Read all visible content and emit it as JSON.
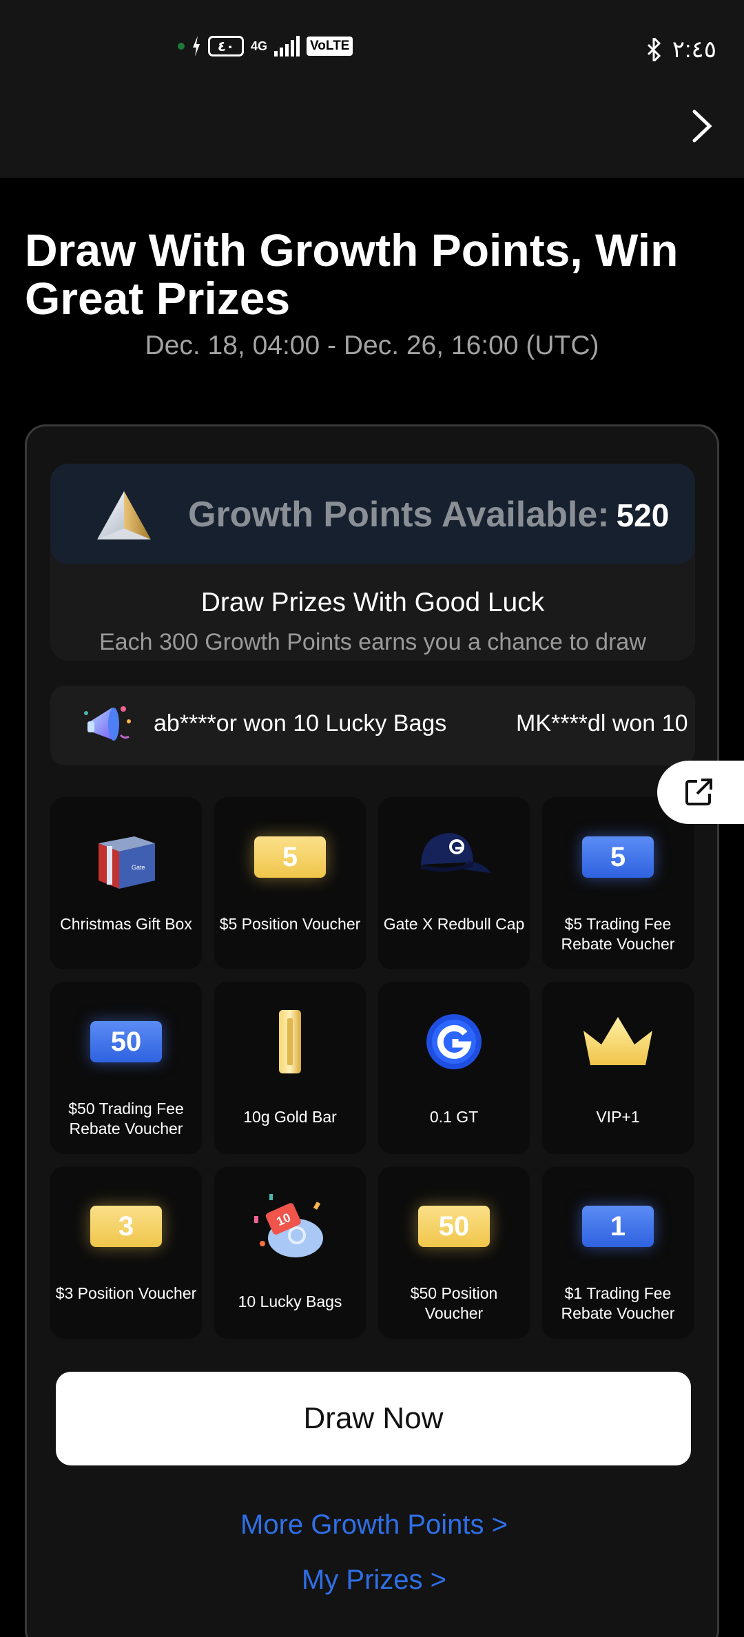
{
  "status_bar": {
    "battery": "٤٠",
    "network": "4G",
    "volte": "VoLTE",
    "time": "٢:٤٥"
  },
  "header": {
    "title": "Draw With Growth Points, Win Great Prizes",
    "dates": "Dec. 18, 04:00 - Dec. 26, 16:00 (UTC)"
  },
  "points": {
    "label": "Growth Points Available:",
    "value": "520",
    "draw_title": "Draw Prizes With Good Luck",
    "draw_subtitle": "Each 300 Growth Points earns you a chance to draw"
  },
  "ticker": {
    "items": [
      "ab****or won 10 Lucky Bags",
      "MK****dl won 10"
    ]
  },
  "prizes": [
    {
      "label": "Christmas Gift Box",
      "icon": "gift-box-icon"
    },
    {
      "label": "$5 Position Voucher",
      "icon": "position-voucher-icon",
      "amount": "5"
    },
    {
      "label": "Gate X Redbull Cap",
      "icon": "cap-icon"
    },
    {
      "label": "$5 Trading Fee Rebate Voucher",
      "icon": "rebate-voucher-icon",
      "amount": "5"
    },
    {
      "label": "$50 Trading Fee Rebate Voucher",
      "icon": "rebate-voucher-icon",
      "amount": "50"
    },
    {
      "label": "10g Gold Bar",
      "icon": "gold-bar-icon"
    },
    {
      "label": "0.1 GT",
      "icon": "gt-coin-icon"
    },
    {
      "label": "VIP+1",
      "icon": "crown-icon"
    },
    {
      "label": "$3 Position Voucher",
      "icon": "position-voucher-icon",
      "amount": "3"
    },
    {
      "label": "10 Lucky Bags",
      "icon": "lucky-bag-icon",
      "amount": "10"
    },
    {
      "label": "$50 Position Voucher",
      "icon": "position-voucher-icon",
      "amount": "50"
    },
    {
      "label": "$1 Trading Fee Rebate Voucher",
      "icon": "rebate-voucher-icon",
      "amount": "1"
    }
  ],
  "actions": {
    "draw_now": "Draw Now",
    "more_points": "More Growth Points  >",
    "my_prizes": "My Prizes  >"
  },
  "colors": {
    "accent_link": "#2f6fe8",
    "background": "#000000",
    "card": "#131313"
  }
}
